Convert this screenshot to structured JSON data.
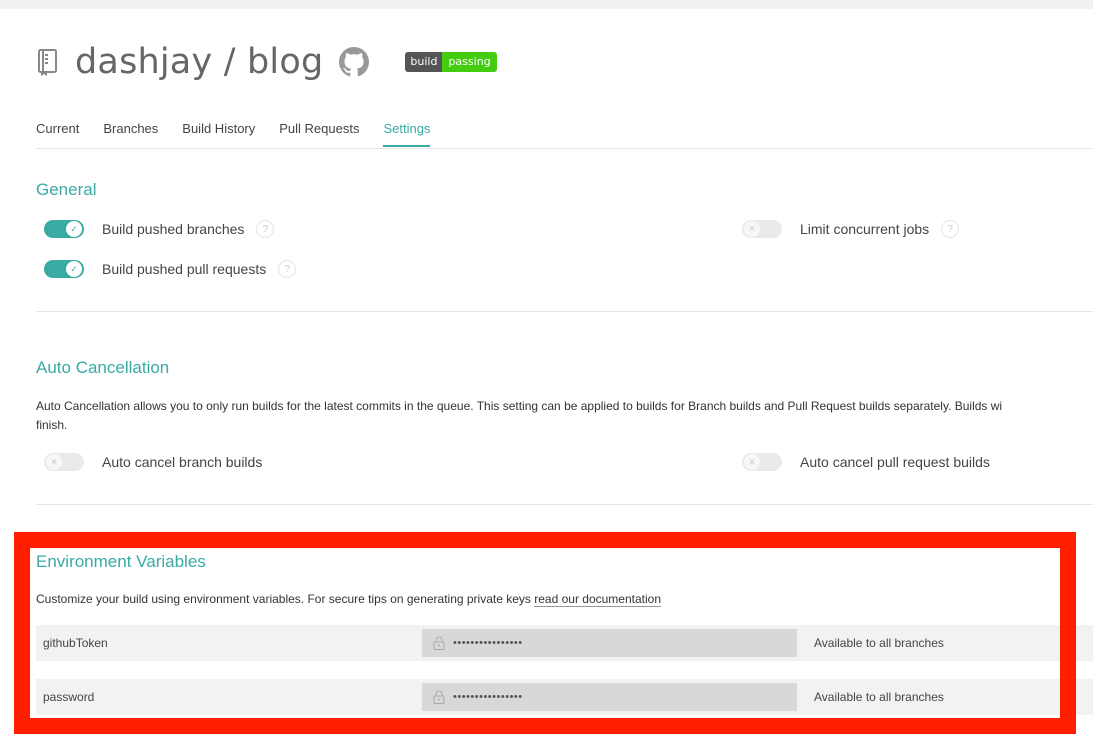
{
  "repo": {
    "title": "dashjay / blog",
    "badge_left": "build",
    "badge_right": "passing"
  },
  "tabs": [
    {
      "label": "Current"
    },
    {
      "label": "Branches"
    },
    {
      "label": "Build History"
    },
    {
      "label": "Pull Requests"
    },
    {
      "label": "Settings",
      "active": true
    }
  ],
  "general": {
    "title": "General",
    "build_pushed_branches": {
      "label": "Build pushed branches",
      "on": true
    },
    "build_pushed_prs": {
      "label": "Build pushed pull requests",
      "on": true
    },
    "limit_concurrent": {
      "label": "Limit concurrent jobs",
      "on": false
    },
    "help_glyph": "?"
  },
  "auto_cancel": {
    "title": "Auto Cancellation",
    "desc_line1": "Auto Cancellation allows you to only run builds for the latest commits in the queue. This setting can be applied to builds for Branch builds and Pull Request builds separately. Builds wi",
    "desc_line2": "finish.",
    "branch_builds": {
      "label": "Auto cancel branch builds",
      "on": false
    },
    "pr_builds": {
      "label": "Auto cancel pull request builds",
      "on": false
    }
  },
  "env": {
    "title": "Environment Variables",
    "desc": "Customize your build using environment variables. For secure tips on generating private keys ",
    "link": "read our documentation",
    "rows": [
      {
        "name": "githubToken",
        "value": "••••••••••••••••",
        "branch": "Available to all branches"
      },
      {
        "name": "password",
        "value": "••••••••••••••••",
        "branch": "Available to all branches"
      }
    ]
  },
  "colors": {
    "accent": "#39aaa4",
    "highlight": "#ff1f00",
    "badge_pass": "#44cc11"
  },
  "glyphs": {
    "check": "✓",
    "cross": "✕"
  }
}
